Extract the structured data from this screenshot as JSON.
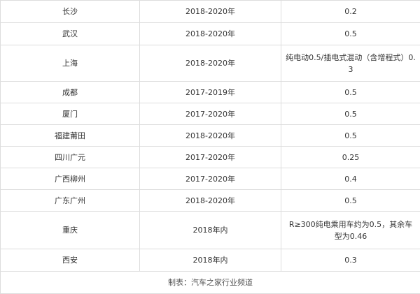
{
  "table": {
    "rows": [
      {
        "city": "长沙",
        "period": "2018-2020年",
        "value": "0.2"
      },
      {
        "city": "武汉",
        "period": "2018-2020年",
        "value": "0.5"
      },
      {
        "city": "上海",
        "period": "2018-2020年",
        "value": "纯电动0.5/插电式混动（含增程式）0.3"
      },
      {
        "city": "成都",
        "period": "2017-2019年",
        "value": "0.5"
      },
      {
        "city": "厦门",
        "period": "2017-2020年",
        "value": "0.5"
      },
      {
        "city": "福建莆田",
        "period": "2018-2020年",
        "value": "0.5"
      },
      {
        "city": "四川广元",
        "period": "2017-2020年",
        "value": "0.25"
      },
      {
        "city": "广西柳州",
        "period": "2017-2020年",
        "value": "0.4"
      },
      {
        "city": "广东广州",
        "period": "2018-2020年",
        "value": "0.5"
      },
      {
        "city": "重庆",
        "period": "2018年内",
        "value": "R≥300纯电乘用车约为0.5，其余车型为0.46"
      },
      {
        "city": "西安",
        "period": "2018年内",
        "value": "0.3"
      }
    ],
    "caption": "制表：汽车之家行业频道"
  }
}
